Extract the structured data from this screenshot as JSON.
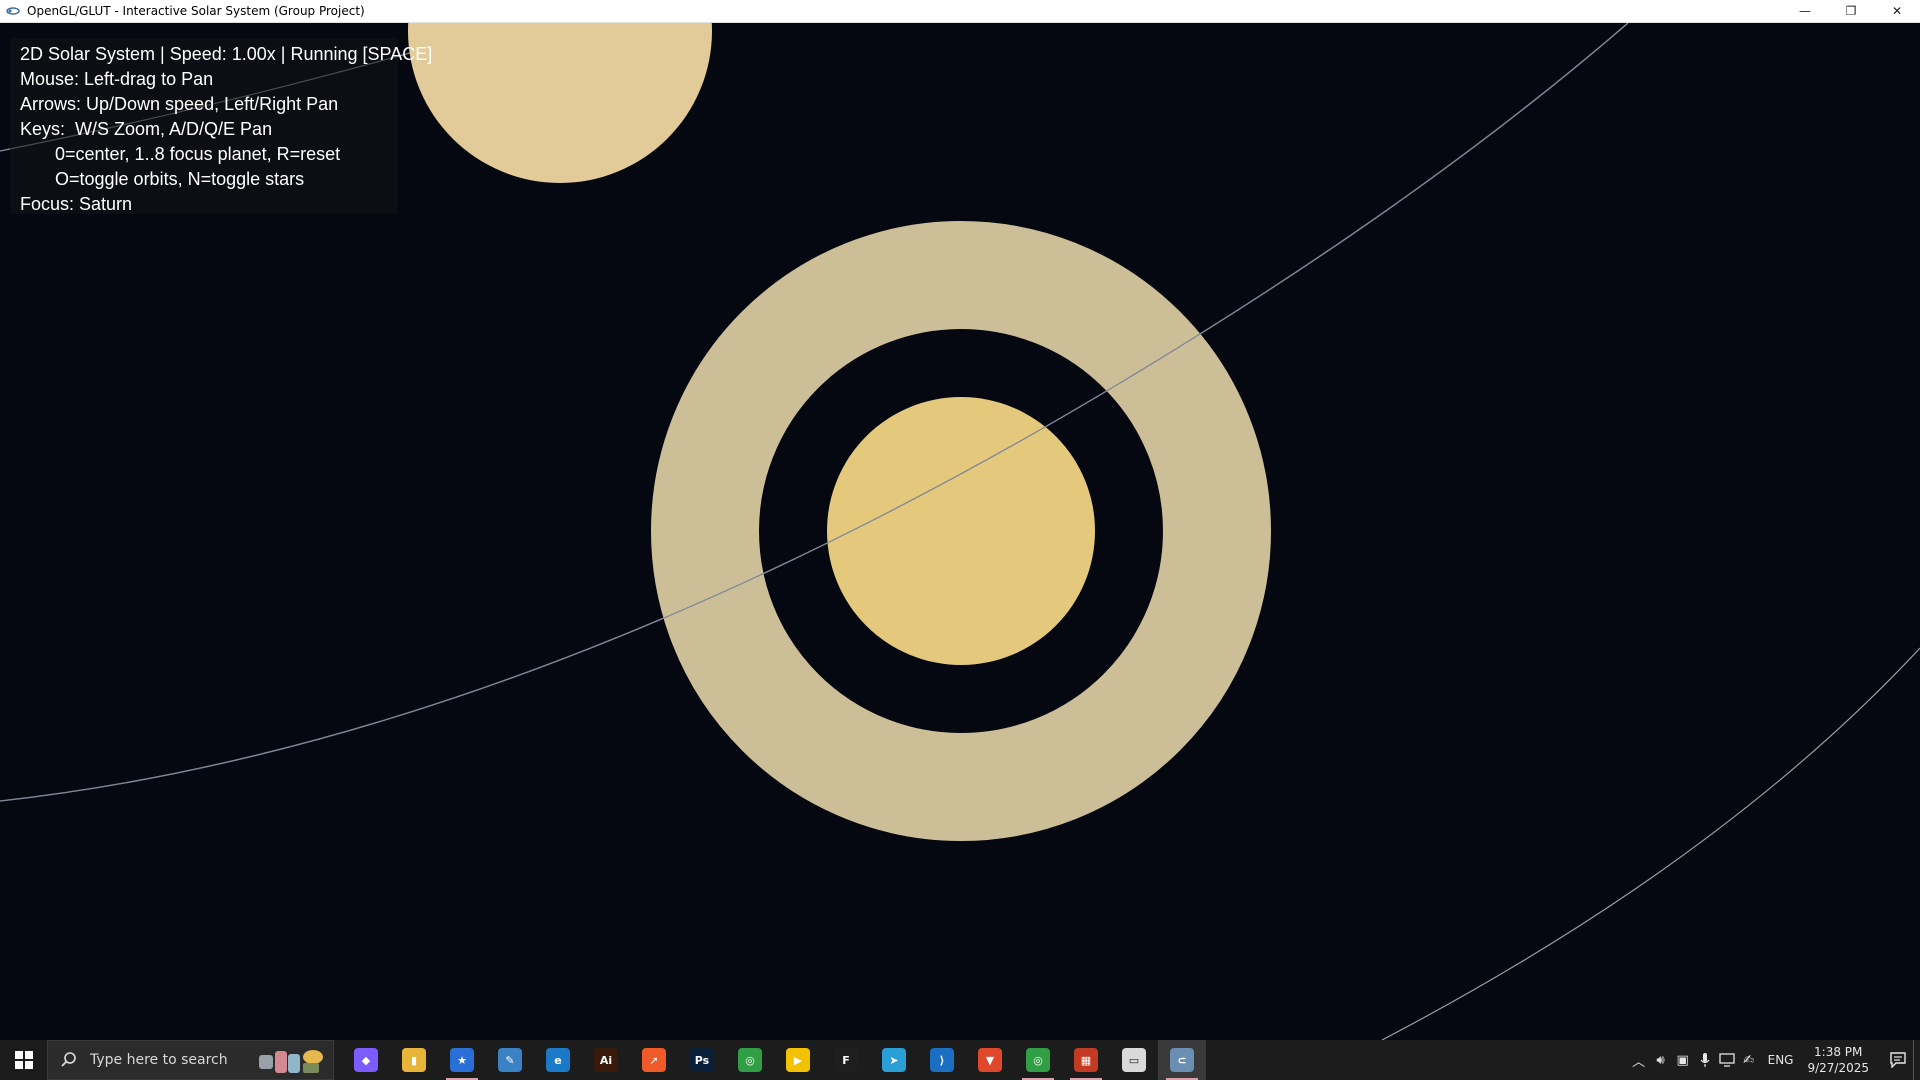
{
  "window": {
    "title": "OpenGL/GLUT - Interactive Solar System (Group Project)",
    "controls": {
      "minimize": "—",
      "restore": "❐",
      "close": "✕"
    }
  },
  "hud": {
    "status": "2D Solar System | Speed: 1.00x | Running [SPACE]",
    "mouse": "Mouse: Left-drag to Pan",
    "arrows": "Arrows: Up/Down speed, Left/Right Pan",
    "keys": "Keys:  W/S Zoom, A/D/Q/E Pan",
    "keys2": "0=center, 1..8 focus planet, R=reset",
    "keys3": "O=toggle orbits, N=toggle stars",
    "focus": "Focus: Saturn"
  },
  "scene": {
    "colors": {
      "background": "#050810",
      "saturn": "#e4c97d",
      "ring": "#ccbf98",
      "neighbor_planet": "#e2cb98",
      "orbit": "#8a8f9e"
    }
  },
  "taskbar": {
    "search_placeholder": "Type here to search",
    "apps": [
      {
        "name": "copilot-app",
        "icon": "copilot-icon",
        "color": "#7b5cff",
        "glyph": "◆"
      },
      {
        "name": "file-explorer-app",
        "icon": "file-folder-icon",
        "color": "#e8b53a",
        "glyph": "▮"
      },
      {
        "name": "starred-app",
        "icon": "star-icon",
        "color": "#2a6fd6",
        "glyph": "★",
        "underline": true
      },
      {
        "name": "notes-app",
        "icon": "notepad-icon",
        "color": "#3b82c4",
        "glyph": "✎"
      },
      {
        "name": "edge-browser",
        "icon": "edge-icon",
        "color": "#1b7ac8",
        "glyph": "e"
      },
      {
        "name": "illustrator-app",
        "icon": "illustrator-icon",
        "color": "#3a1a08",
        "glyph": "Ai"
      },
      {
        "name": "swift-app",
        "icon": "swift-icon",
        "color": "#f05a28",
        "glyph": "➚"
      },
      {
        "name": "photoshop-app",
        "icon": "photoshop-icon",
        "color": "#0a1f3a",
        "glyph": "Ps"
      },
      {
        "name": "chrome-browser",
        "icon": "chrome-icon",
        "color": "#2f9e44",
        "glyph": "◎"
      },
      {
        "name": "player-app",
        "icon": "player-icon",
        "color": "#f2c200",
        "glyph": "▶"
      },
      {
        "name": "figma-app",
        "icon": "figma-icon",
        "color": "#1e1e1e",
        "glyph": "F"
      },
      {
        "name": "telegram-app",
        "icon": "telegram-icon",
        "color": "#2a9fd6",
        "glyph": "➤"
      },
      {
        "name": "vscode-app",
        "icon": "vscode-icon",
        "color": "#1b6fc2",
        "glyph": "⟩"
      },
      {
        "name": "brave-browser",
        "icon": "brave-icon",
        "color": "#e0482b",
        "glyph": "▼"
      },
      {
        "name": "chrome-profile",
        "icon": "chrome-profile-icon",
        "color": "#2f9e44",
        "glyph": "◎",
        "underline": true
      },
      {
        "name": "windows-store",
        "icon": "store-icon",
        "color": "#c23b22",
        "glyph": "▦",
        "underline": true
      },
      {
        "name": "terminal-app",
        "icon": "terminal-icon",
        "color": "#d9d9d9",
        "glyph": "▭"
      },
      {
        "name": "opengl-window",
        "icon": "glut-icon",
        "color": "#6a8fb3",
        "glyph": "⊂",
        "active": true,
        "underline": true
      }
    ],
    "tray": {
      "language": "ENG",
      "time": "1:38 PM",
      "date": "9/27/2025"
    }
  }
}
